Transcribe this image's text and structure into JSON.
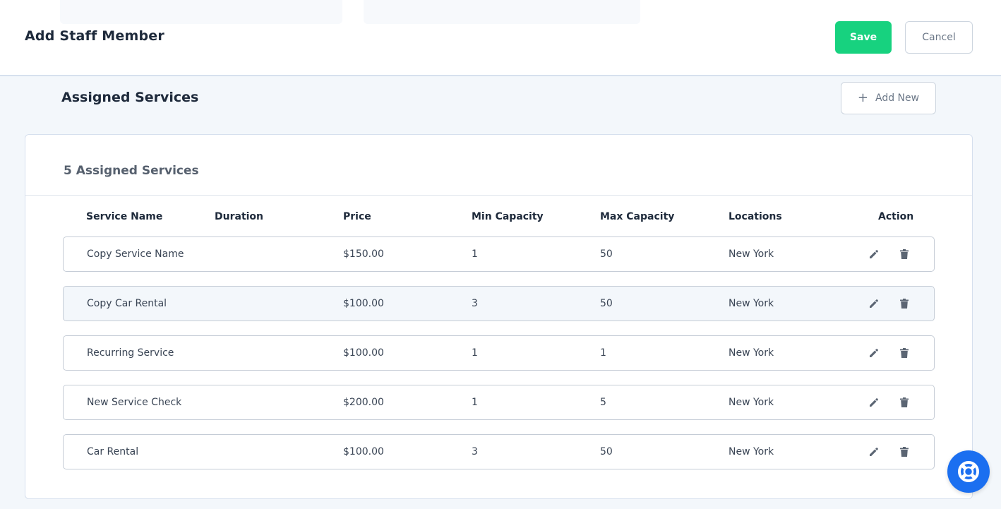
{
  "header": {
    "title": "Add Staff Member",
    "save_label": "Save",
    "cancel_label": "Cancel"
  },
  "section": {
    "title": "Assigned Services",
    "add_label": "Add New"
  },
  "card": {
    "title": "5 Assigned Services"
  },
  "table": {
    "columns": [
      "Service Name",
      "Duration",
      "Price",
      "Min Capacity",
      "Max Capacity",
      "Locations",
      "Action"
    ],
    "rows": [
      {
        "name": "Copy Service Name",
        "duration": "",
        "price": "$150.00",
        "min": "1",
        "max": "50",
        "location": "New York"
      },
      {
        "name": "Copy Car Rental",
        "duration": "",
        "price": "$100.00",
        "min": "3",
        "max": "50",
        "location": "New York"
      },
      {
        "name": "Recurring Service",
        "duration": "",
        "price": "$100.00",
        "min": "1",
        "max": "1",
        "location": "New York"
      },
      {
        "name": "New Service Check",
        "duration": "",
        "price": "$200.00",
        "min": "1",
        "max": "5",
        "location": "New York"
      },
      {
        "name": "Car Rental",
        "duration": "",
        "price": "$100.00",
        "min": "3",
        "max": "50",
        "location": "New York"
      }
    ]
  },
  "icons": {
    "edit": "pencil-icon",
    "delete": "trash-icon",
    "add": "plus-icon",
    "help": "lifebuoy-icon"
  },
  "colors": {
    "save_button": "#17d27f",
    "help_button": "#1b6ff0",
    "page_background": "#f3f7fb",
    "highlighted_row": "#f3f7fb"
  }
}
